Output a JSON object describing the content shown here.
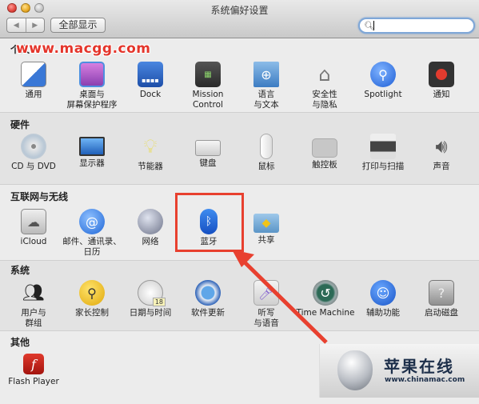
{
  "window": {
    "title": "系统偏好设置",
    "back_label": "◀",
    "forward_label": "▶",
    "show_all_label": "全部显示",
    "search": {
      "value": "",
      "placeholder": ""
    }
  },
  "watermark": "www.macgg.com",
  "sections": [
    {
      "title": "个人",
      "title_hidden_by_watermark": true,
      "items": [
        {
          "label": "通用",
          "icon": "general-icon"
        },
        {
          "label": "桌面与\n屏幕保护程序",
          "icon": "desktop-icon"
        },
        {
          "label": "Dock",
          "icon": "dock-icon"
        },
        {
          "label": "Mission\nControl",
          "icon": "mission-control-icon"
        },
        {
          "label": "语言\n与文本",
          "icon": "language-icon"
        },
        {
          "label": "安全性\n与隐私",
          "icon": "security-icon"
        },
        {
          "label": "Spotlight",
          "icon": "spotlight-icon"
        },
        {
          "label": "通知",
          "icon": "notifications-icon"
        }
      ]
    },
    {
      "title": "硬件",
      "items": [
        {
          "label": "CD 与 DVD",
          "icon": "cd-dvd-icon"
        },
        {
          "label": "显示器",
          "icon": "display-icon"
        },
        {
          "label": "节能器",
          "icon": "energy-saver-icon"
        },
        {
          "label": "键盘",
          "icon": "keyboard-icon"
        },
        {
          "label": "鼠标",
          "icon": "mouse-icon"
        },
        {
          "label": "触控板",
          "icon": "trackpad-icon"
        },
        {
          "label": "打印与扫描",
          "icon": "printer-icon"
        },
        {
          "label": "声音",
          "icon": "sound-icon"
        }
      ]
    },
    {
      "title": "互联网与无线",
      "items": [
        {
          "label": "iCloud",
          "icon": "icloud-icon"
        },
        {
          "label": "邮件、通讯录、\n日历",
          "icon": "mail-icon"
        },
        {
          "label": "网络",
          "icon": "network-icon"
        },
        {
          "label": "蓝牙",
          "icon": "bluetooth-icon"
        },
        {
          "label": "共享",
          "icon": "sharing-icon"
        }
      ]
    },
    {
      "title": "系统",
      "items": [
        {
          "label": "用户与\n群组",
          "icon": "users-icon"
        },
        {
          "label": "家长控制",
          "icon": "parental-controls-icon"
        },
        {
          "label": "日期与时间",
          "icon": "date-time-icon"
        },
        {
          "label": "软件更新",
          "icon": "software-update-icon"
        },
        {
          "label": "听写\n与语音",
          "icon": "dictation-icon"
        },
        {
          "label": "Time Machine",
          "icon": "time-machine-icon"
        },
        {
          "label": "辅助功能",
          "icon": "accessibility-icon"
        },
        {
          "label": "启动磁盘",
          "icon": "startup-disk-icon"
        }
      ]
    },
    {
      "title": "其他",
      "items": [
        {
          "label": "Flash Player",
          "icon": "flash-player-icon"
        }
      ]
    }
  ],
  "annotation": {
    "highlighted_item": "蓝牙",
    "color": "#e8402f"
  },
  "logo": {
    "name": "苹果在线",
    "url": "www.chinamac.com"
  },
  "date_icon_text": "18"
}
